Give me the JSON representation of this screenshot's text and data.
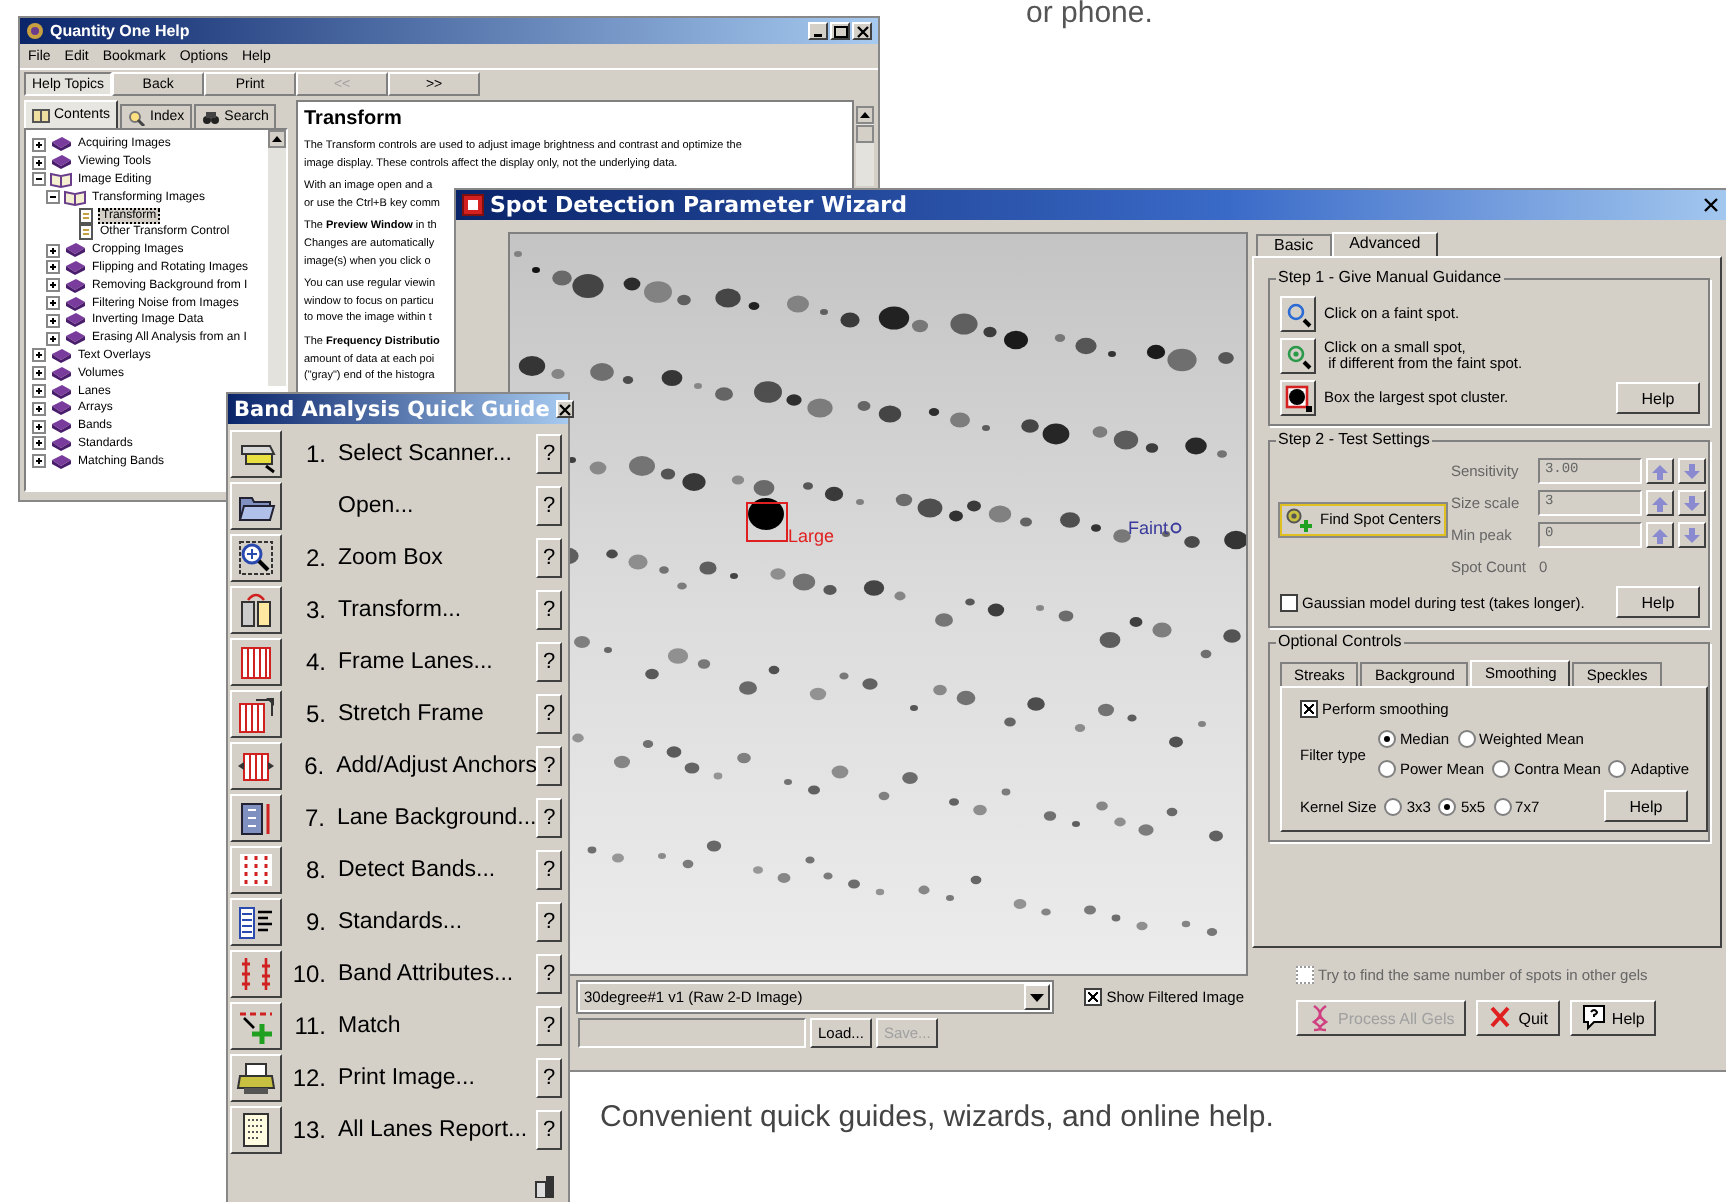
{
  "caption_top": "or phone.",
  "help_window": {
    "title": "Quantity One Help",
    "menu": [
      "File",
      "Edit",
      "Bookmark",
      "Options",
      "Help"
    ],
    "toolbar": [
      {
        "label": "Help Topics",
        "selected": true,
        "disabled": false
      },
      {
        "label": "Back",
        "selected": false,
        "disabled": false
      },
      {
        "label": "Print",
        "selected": false,
        "disabled": false
      },
      {
        "label": "<<",
        "selected": false,
        "disabled": true
      },
      {
        "label": ">>",
        "selected": false,
        "disabled": false
      }
    ],
    "tabs": [
      {
        "label": "Contents",
        "selected": true
      },
      {
        "label": "Index",
        "selected": false
      },
      {
        "label": "Search",
        "selected": false
      }
    ],
    "tree": [
      {
        "label": "Acquiring Images",
        "kind": "book",
        "expanded": false,
        "selected": false
      },
      {
        "label": "Viewing Tools",
        "kind": "book",
        "expanded": false,
        "selected": false
      },
      {
        "label": "Image Editing",
        "kind": "book",
        "expanded": true,
        "selected": false,
        "children": [
          {
            "label": "Transforming Images",
            "kind": "book",
            "expanded": true,
            "selected": false,
            "children": [
              {
                "label": "Transform",
                "kind": "page",
                "selected": true
              },
              {
                "label": "Other Transform Control",
                "kind": "page",
                "selected": false
              }
            ]
          },
          {
            "label": "Cropping Images",
            "kind": "book",
            "expanded": false,
            "selected": false
          },
          {
            "label": "Flipping and Rotating Images",
            "kind": "book",
            "expanded": false,
            "selected": false
          },
          {
            "label": "Removing Background from I",
            "kind": "book",
            "expanded": false,
            "selected": false
          },
          {
            "label": "Filtering Noise from Images",
            "kind": "book",
            "expanded": false,
            "selected": false
          },
          {
            "label": "Inverting Image Data",
            "kind": "book",
            "expanded": false,
            "selected": false
          },
          {
            "label": "Erasing All Analysis from an I",
            "kind": "book",
            "expanded": false,
            "selected": false
          }
        ]
      },
      {
        "label": "Text Overlays",
        "kind": "book",
        "expanded": false,
        "selected": false
      },
      {
        "label": "Volumes",
        "kind": "book",
        "expanded": false,
        "selected": false
      },
      {
        "label": "Lanes",
        "kind": "book",
        "expanded": false,
        "selected": false
      },
      {
        "label": "Arrays",
        "kind": "book",
        "expanded": false,
        "selected": false
      },
      {
        "label": "Bands",
        "kind": "book",
        "expanded": false,
        "selected": false
      },
      {
        "label": "Standards",
        "kind": "book",
        "expanded": false,
        "selected": false
      },
      {
        "label": "Matching Bands",
        "kind": "book",
        "expanded": false,
        "selected": false
      }
    ],
    "topic": {
      "heading": "Transform",
      "paragraphs": [
        [
          "The Transform controls are used to adjust image brightness and contrast and optimize the",
          "image display.  These controls affect the display only, not the underlying data."
        ],
        [
          "With an image open and a",
          "or use the Ctrl+B key comm"
        ],
        [
          "The **Preview Window** in th",
          "Changes are automatically",
          "image(s) when you click o"
        ],
        [
          "You can use regular viewin",
          "window to focus on particu",
          "to move the image within t"
        ],
        [
          "The **Frequency Distributio**",
          "amount of data at each poi",
          "(\"gray\") end of the histogra"
        ]
      ]
    }
  },
  "wizard": {
    "title": "Spot Detection Parameter Wizard",
    "image_labels": [
      {
        "text": "Large",
        "kind": "box"
      },
      {
        "text": "Faint",
        "kind": "circle"
      }
    ],
    "image_selector": "30degree#1 v1 (Raw 2-D Image)",
    "show_filtered": {
      "label": "Show Filtered Image",
      "checked": true
    },
    "file_buttons": [
      {
        "label": "Load...",
        "disabled": false
      },
      {
        "label": "Save...",
        "disabled": true
      }
    ],
    "tabs": [
      {
        "label": "Basic",
        "selected": false
      },
      {
        "label": "Advanced",
        "selected": true
      }
    ],
    "step1": {
      "title": "Step 1 - Give Manual Guidance",
      "rows": [
        {
          "text": "Click on a faint spot."
        },
        {
          "text": "Click on a small spot,\n if different from the faint spot."
        },
        {
          "text": "Box the largest spot cluster."
        }
      ],
      "help": "Help"
    },
    "step2": {
      "title": "Step 2 - Test Settings",
      "button": "Find Spot Centers",
      "settings": [
        {
          "label": "Sensitivity",
          "value": "3.00",
          "disabled": true
        },
        {
          "label": "Size scale",
          "value": "3",
          "disabled": true
        },
        {
          "label": "Min peak",
          "value": "0",
          "disabled": true
        }
      ],
      "spot_count": {
        "label": "Spot Count",
        "value": "0"
      },
      "gaussian": {
        "label": "Gaussian model during test (takes longer).",
        "checked": false
      },
      "help": "Help"
    },
    "optional": {
      "title": "Optional Controls",
      "tabs": [
        {
          "label": "Streaks",
          "selected": false
        },
        {
          "label": "Background",
          "selected": false
        },
        {
          "label": "Smoothing",
          "selected": true
        },
        {
          "label": "Speckles",
          "selected": false
        }
      ],
      "perform": {
        "label": "Perform smoothing",
        "checked": true
      },
      "filter_label": "Filter type",
      "filters": [
        {
          "label": "Median",
          "selected": true
        },
        {
          "label": "Weighted Mean",
          "selected": false
        },
        {
          "label": "Power Mean",
          "selected": false
        },
        {
          "label": "Contra Mean",
          "selected": false
        },
        {
          "label": "Adaptive",
          "selected": false
        }
      ],
      "kernel_label": "Kernel Size",
      "kernels": [
        {
          "label": "3x3",
          "selected": false
        },
        {
          "label": "5x5",
          "selected": true
        },
        {
          "label": "7x7",
          "selected": false
        }
      ],
      "help": "Help"
    },
    "same_spots": {
      "label": "Try to find the same number of spots in other gels",
      "checked": false,
      "disabled": true
    },
    "buttons": [
      {
        "label": "Process All Gels",
        "disabled": true
      },
      {
        "label": "Quit",
        "disabled": false
      },
      {
        "label": "Help",
        "disabled": false
      }
    ]
  },
  "quick_guide": {
    "title": "Band Analysis Quick Guide",
    "items": [
      {
        "number": "1.",
        "label": "Select Scanner...",
        "help": "?"
      },
      {
        "label": "Open...",
        "help": "?"
      },
      {
        "number": "2.",
        "label": "Zoom Box",
        "help": "?"
      },
      {
        "number": "3.",
        "label": "Transform...",
        "help": "?"
      },
      {
        "number": "4.",
        "label": "Frame Lanes...",
        "help": "?"
      },
      {
        "number": "5.",
        "label": "Stretch Frame",
        "help": "?"
      },
      {
        "number": "6.",
        "label": "Add/Adjust Anchors",
        "help": "?"
      },
      {
        "number": "7.",
        "label": "Lane Background...",
        "help": "?"
      },
      {
        "number": "8.",
        "label": "Detect Bands...",
        "help": "?"
      },
      {
        "number": "9.",
        "label": "Standards...",
        "help": "?"
      },
      {
        "number": "10.",
        "label": "Band Attributes...",
        "help": "?"
      },
      {
        "number": "11.",
        "label": "Match",
        "help": "?"
      },
      {
        "number": "12.",
        "label": "Print Image...",
        "help": "?"
      },
      {
        "number": "13.",
        "label": "All Lanes Report...",
        "help": "?"
      }
    ]
  },
  "caption": "Convenient quick guides, wizards, and online help."
}
